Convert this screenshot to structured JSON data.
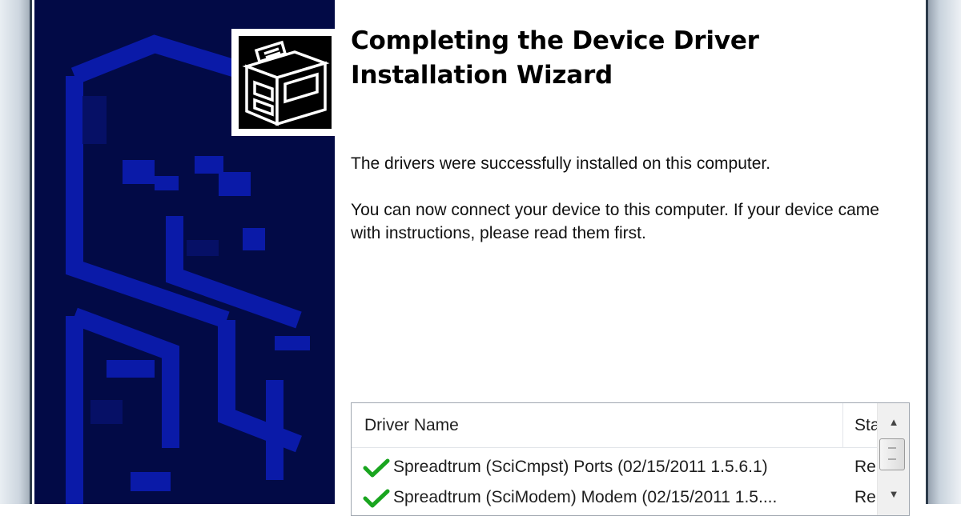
{
  "wizard": {
    "title_line1": "Completing the Device Driver",
    "title_line2": "Installation Wizard",
    "message_success": "The drivers were successfully installed on this computer.",
    "message_connect": "You can now connect your device to this computer. If your device came with instructions, please read them first."
  },
  "driver_list": {
    "columns": [
      "Driver Name",
      "Sta"
    ],
    "rows": [
      {
        "name": "Spreadtrum (SciCmpst) Ports  (02/15/2011 1.5.6.1)",
        "status": "Re",
        "icon": "green-check-icon"
      },
      {
        "name": "Spreadtrum (SciModem) Modem  (02/15/2011 1.5....",
        "status": "Re",
        "icon": "green-check-icon"
      }
    ]
  },
  "colors": {
    "banner": "#020a46",
    "banner_shapes": "#0a1aa8",
    "check": "#19a51f"
  }
}
